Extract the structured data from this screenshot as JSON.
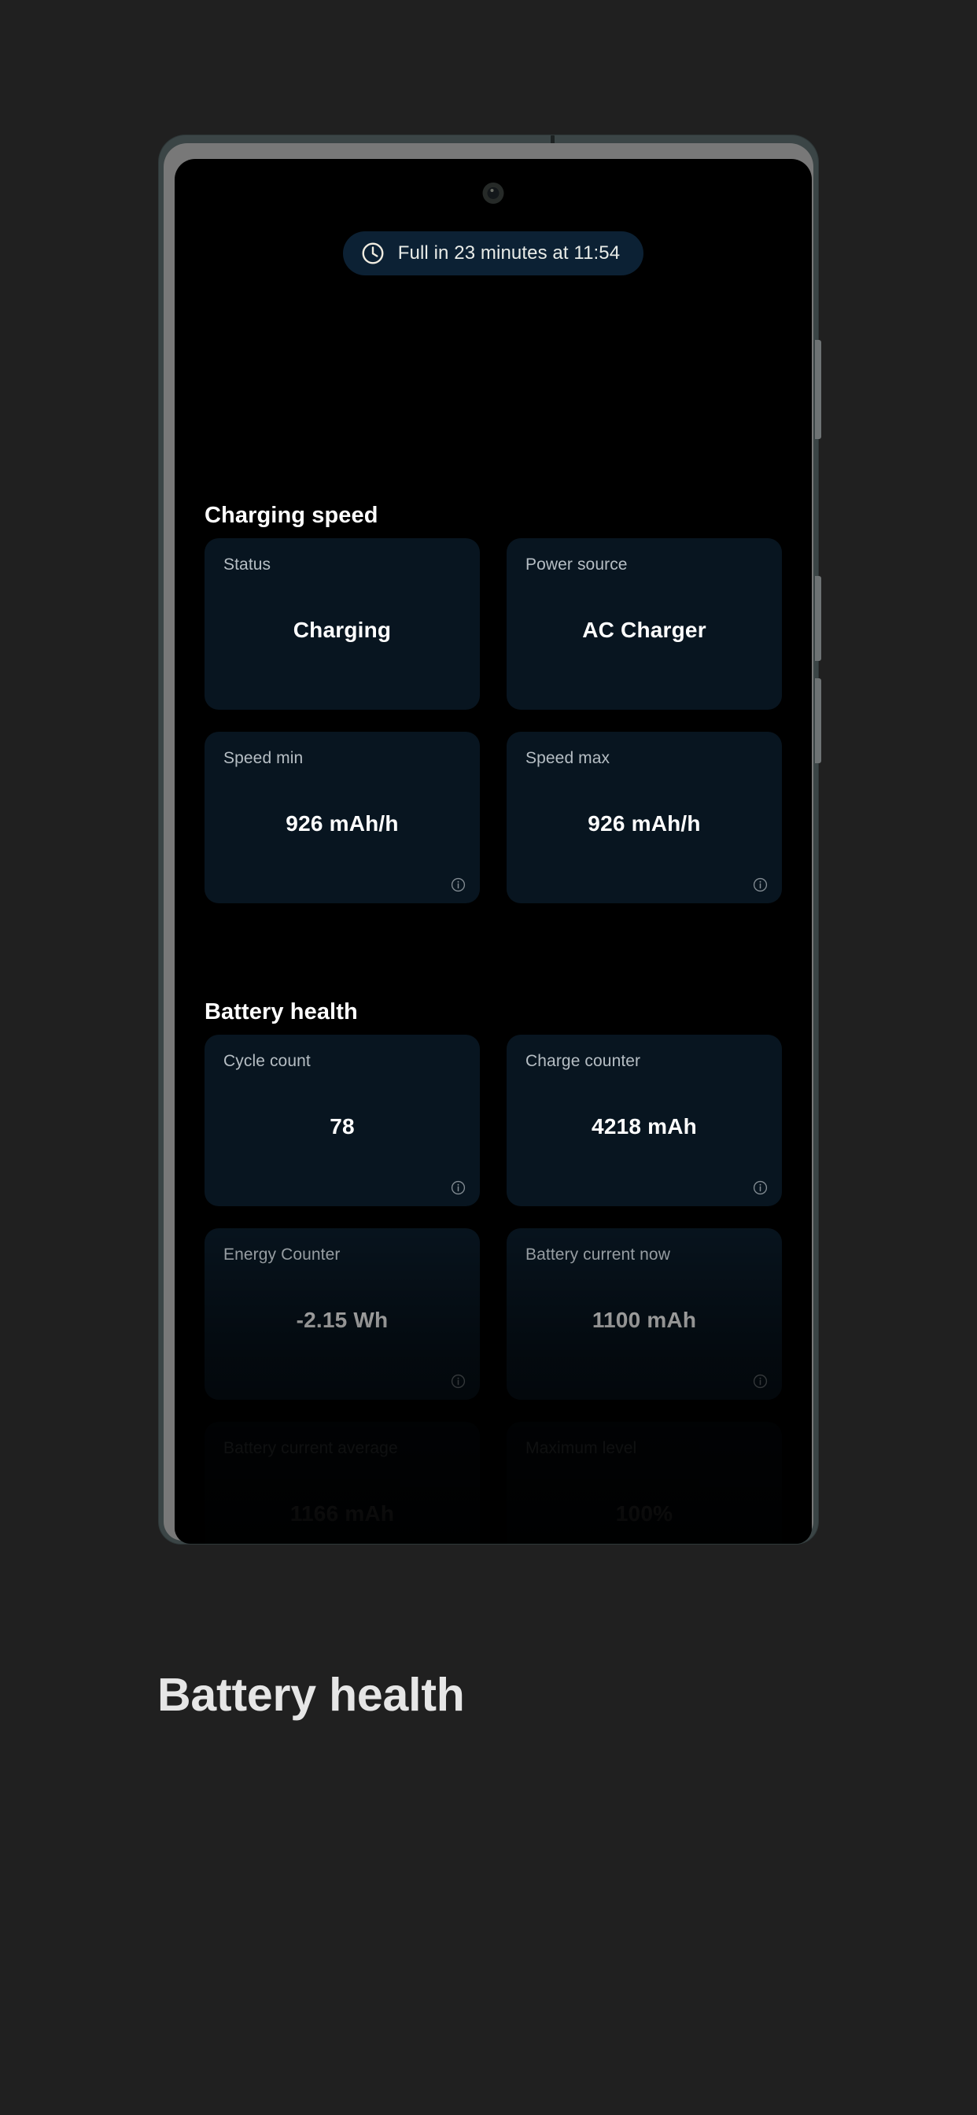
{
  "device": {
    "status_bar": {
      "pill_icon": "clock-icon",
      "pill_text": "Full in 23 minutes at 11:54"
    }
  },
  "sections": [
    {
      "id": "charging-speed",
      "title": "Charging speed",
      "cards": [
        {
          "label": "Status",
          "value": "Charging",
          "info": false,
          "dim": false
        },
        {
          "label": "Power source",
          "value": "AC Charger",
          "info": false,
          "dim": false
        },
        {
          "label": "Speed min",
          "value": "926 mAh/h",
          "info": true,
          "dim": false
        },
        {
          "label": "Speed max",
          "value": "926 mAh/h",
          "info": true,
          "dim": false
        }
      ]
    },
    {
      "id": "battery-health",
      "title": "Battery health",
      "cards": [
        {
          "label": "Cycle count",
          "value": "78",
          "info": true,
          "dim": false
        },
        {
          "label": "Charge counter",
          "value": "4218 mAh",
          "info": true,
          "dim": false
        },
        {
          "label": "Energy Counter",
          "value": "-2.15 Wh",
          "info": true,
          "dim": false
        },
        {
          "label": "Battery current now",
          "value": "1100 mAh",
          "info": true,
          "dim": false
        },
        {
          "label": "Battery current average",
          "value": "1166 mAh",
          "info": true,
          "dim": true
        },
        {
          "label": "Maximum level",
          "value": "100%",
          "info": true,
          "dim": true
        }
      ]
    }
  ],
  "caption": "Battery health",
  "colors": {
    "page_background": "#202020",
    "screen_background": "#000000",
    "card_background": "#081520",
    "pill_background": "#0c2134",
    "card_label": "#b6bec4",
    "card_value": "#ffffff",
    "phone_body": "#3b4546",
    "phone_rim": "#787878"
  }
}
